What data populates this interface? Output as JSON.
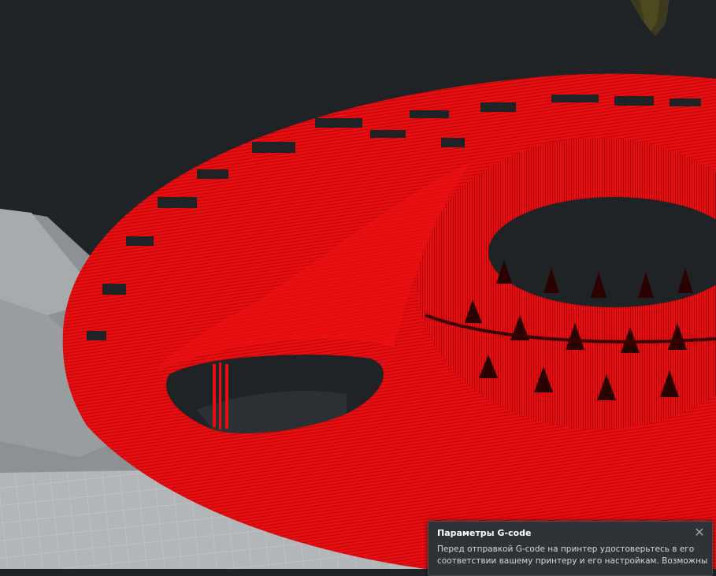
{
  "colors": {
    "background": "#1f2326",
    "layer_red": "#e80d10",
    "shadow_red": "#8a0608",
    "plate_grey": "#b3b6b9",
    "grid_line": "#c9cccf",
    "toast_bg": "#2f3337"
  },
  "viewport": {
    "object_icon": "red-gcode-layers-render"
  },
  "notification": {
    "title": "Параметры G-code",
    "body_line_1": "Перед отправкой G-code на принтер удостоверьтесь в его",
    "body_line_2": "соответствии вашему принтеру и его настройкам. Возможны",
    "close_glyph": "✕"
  }
}
